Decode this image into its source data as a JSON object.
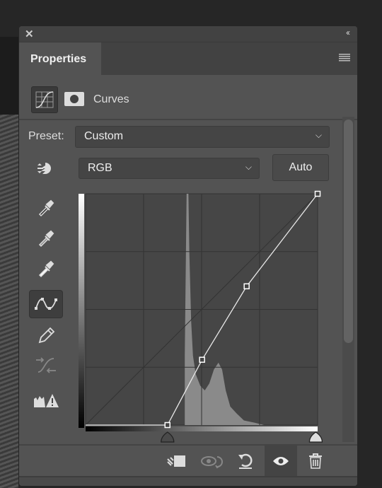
{
  "panel": {
    "title": "Properties",
    "close_icon": "close-icon",
    "collapse_icon": "double-chevron-left-icon",
    "menu_icon": "hamburger-menu-icon"
  },
  "header": {
    "title": "Curves",
    "adjustment_icon": "curves-adjustment-icon",
    "mask_icon": "layer-mask-icon"
  },
  "preset": {
    "label": "Preset:",
    "value": "Custom"
  },
  "channel": {
    "value": "RGB"
  },
  "auto_label": "Auto",
  "tools": [
    "targeted-adjustment-icon",
    "black-point-eyedropper-icon",
    "gray-point-eyedropper-icon",
    "white-point-eyedropper-icon",
    "curve-point-icon",
    "pencil-icon",
    "smooth-icon",
    "clipping-warning-icon"
  ],
  "curve": {
    "input_range": [
      0,
      255
    ],
    "output_range": [
      0,
      255
    ],
    "points": [
      [
        0,
        0
      ],
      [
        90,
        0
      ],
      [
        128,
        72
      ],
      [
        177,
        153
      ],
      [
        255,
        255
      ]
    ],
    "black_input": 90,
    "white_input": 255
  },
  "footer": [
    "clip-to-layer-icon",
    "view-previous-state-icon",
    "reset-icon",
    "visibility-eye-icon",
    "delete-trash-icon"
  ]
}
